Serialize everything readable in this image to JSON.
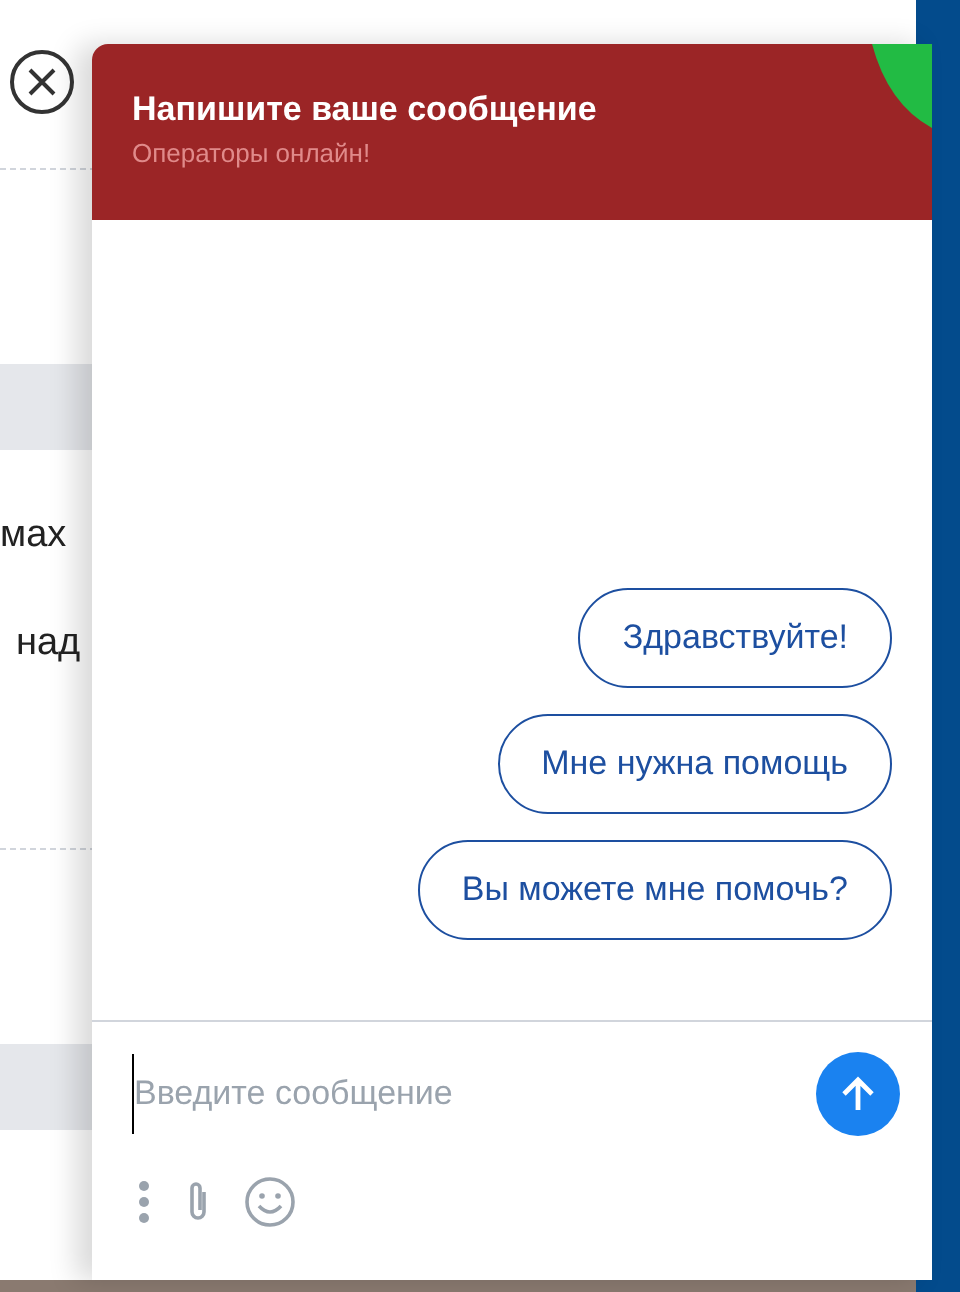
{
  "background_page": {
    "text_lines": [
      "мах",
      "над"
    ]
  },
  "chat": {
    "title": "Напишите ваше сообщение",
    "subtitle": "Операторы онлайн!",
    "quick_replies": [
      "Здравствуйте!",
      "Мне нужна помощь",
      "Вы можете мне помочь?"
    ],
    "input": {
      "placeholder": "Введите сообщение"
    }
  }
}
